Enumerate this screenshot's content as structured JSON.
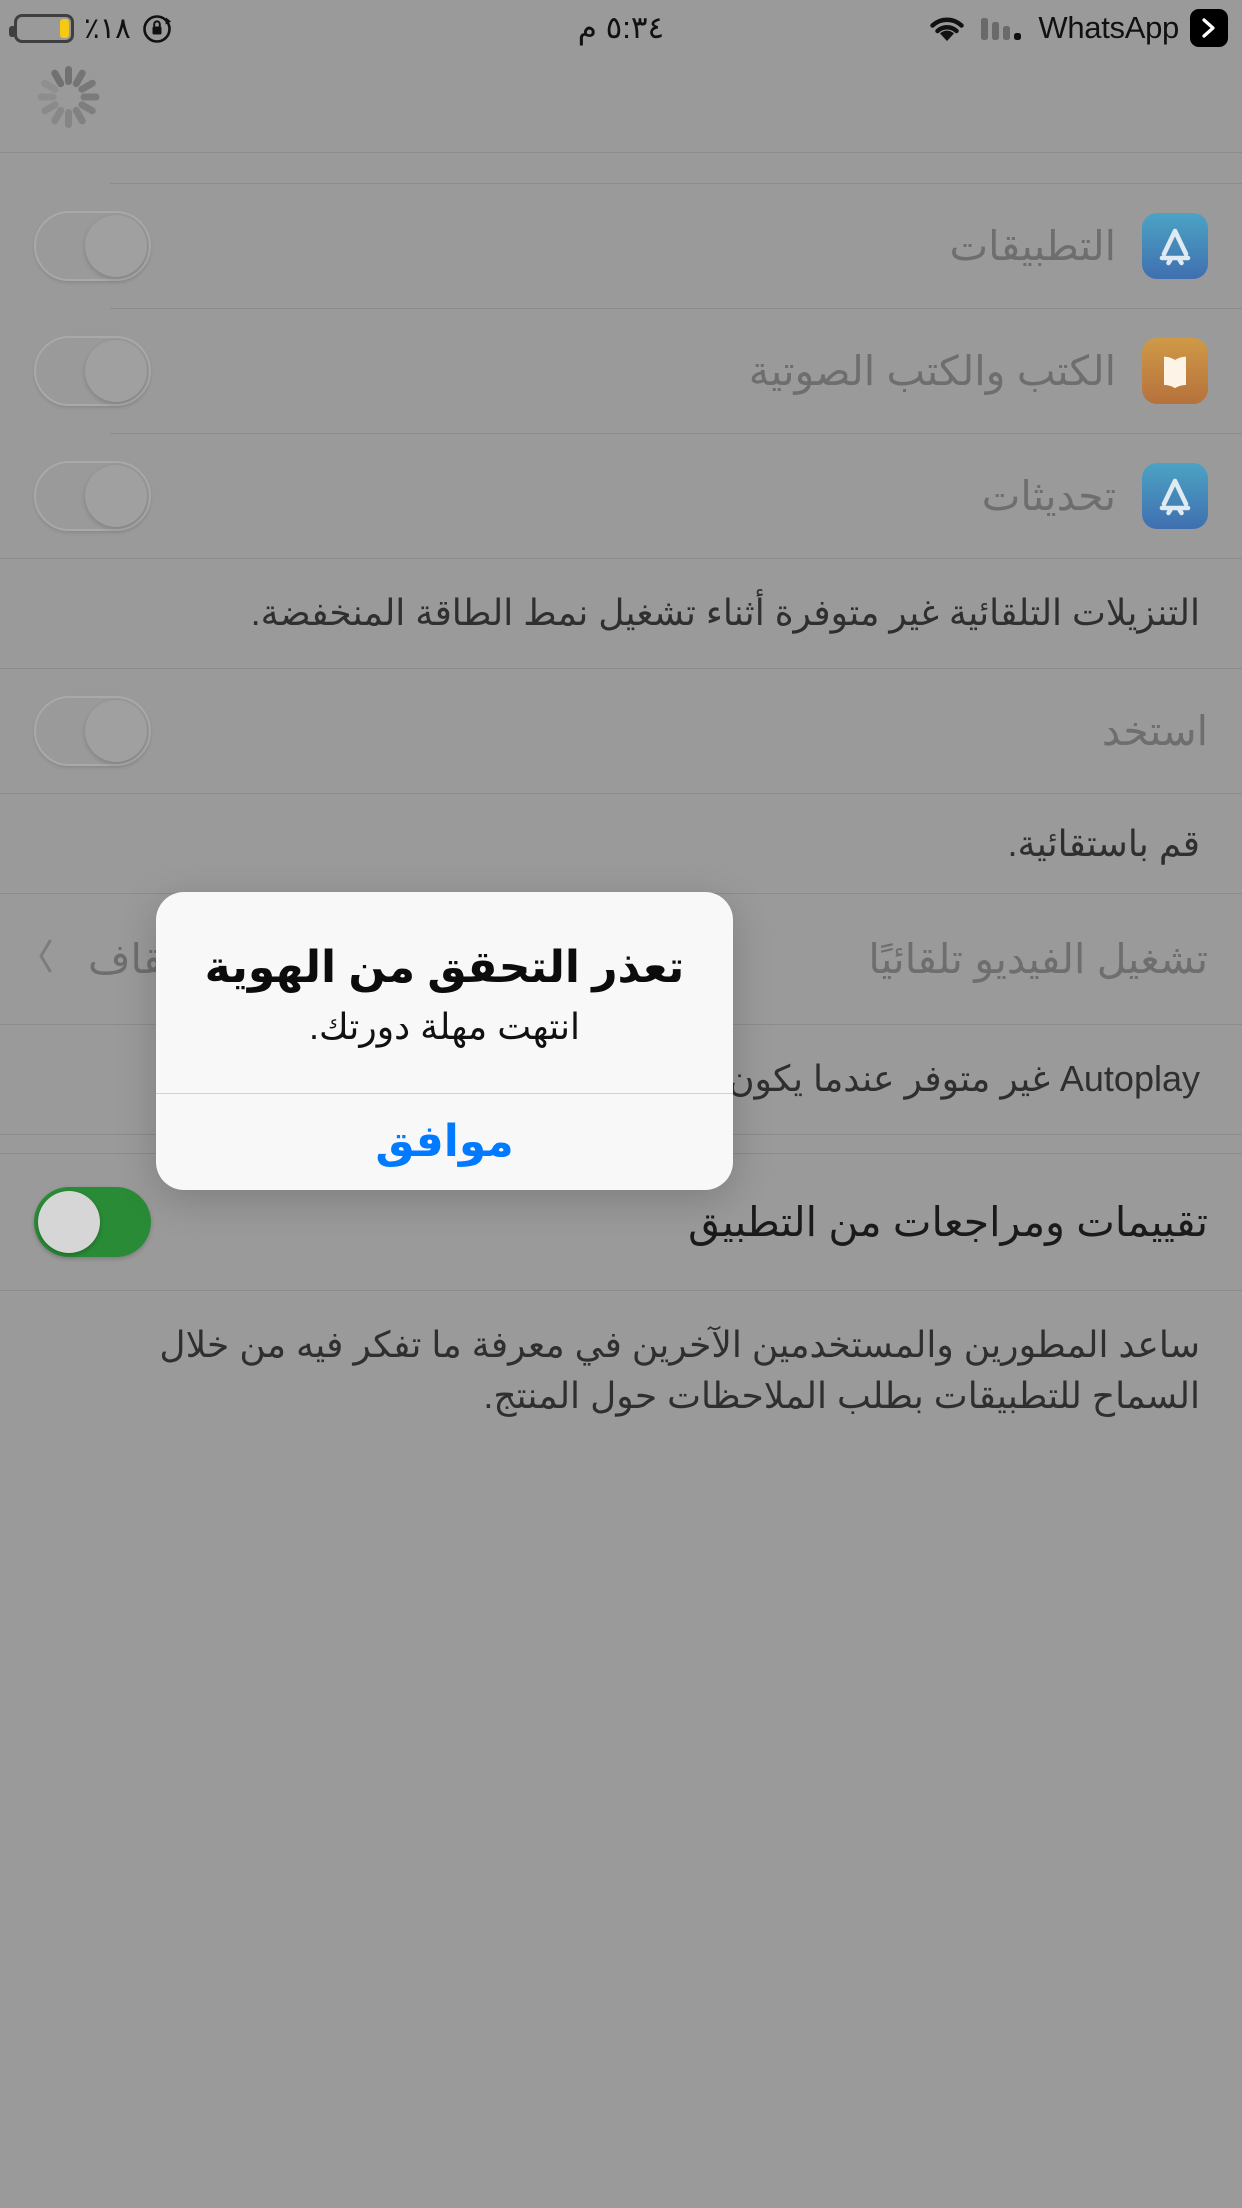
{
  "status_bar": {
    "battery_percent_label": "٪١٨",
    "battery_level": 18,
    "battery_color": "#f6c915",
    "rotation_lock_icon": "rotation-lock-icon",
    "time": "٥:٣٤ م",
    "wifi_icon": "wifi-icon",
    "signal_icon": "cellular-signal-icon",
    "carrier_app_label": "WhatsApp",
    "back_chip_icon": "back-chevron-icon"
  },
  "spinner": {
    "name": "loading-spinner"
  },
  "settings": {
    "auto_downloads_rows": [
      {
        "label": "التطبيقات",
        "icon": "app-store-icon",
        "toggle": "off"
      },
      {
        "label": "الكتب والكتب الصوتية",
        "icon": "books-icon",
        "toggle": "off"
      },
      {
        "label": "تحديثات",
        "icon": "app-store-icon",
        "toggle": "off"
      }
    ],
    "auto_downloads_footer": "التنزيلات التلقائية غير متوفرة أثناء تشغيل نمط الطاقة المنخفضة.",
    "cellular_row": {
      "label": "استخد",
      "toggle": "off"
    },
    "cellular_footer": "قم باست‏قائية.",
    "autoplay_row": {
      "label": "تشغيل الفيديو تلقائيًا",
      "value": "إيقاف",
      "chevron": "chevron-left-icon"
    },
    "autoplay_footer": "Autoplay غير متوفر عندما يكون نمط الطاقة المنخفضة قيد التشغيل.",
    "ratings_row": {
      "label": "تقييمات ومراجعات من التطبيق",
      "toggle": "on"
    },
    "ratings_footer": "ساعد المطورين والمستخدمين الآخرين في معرفة ما تفكر فيه من خلال السماح للتطبيقات بطلب الملاحظات حول المنتج."
  },
  "alert": {
    "title": "تعذر التحقق من الهوية",
    "message": "انتهت مهلة دورتك.",
    "ok_label": "موافق",
    "accent_color": "#027aff"
  }
}
